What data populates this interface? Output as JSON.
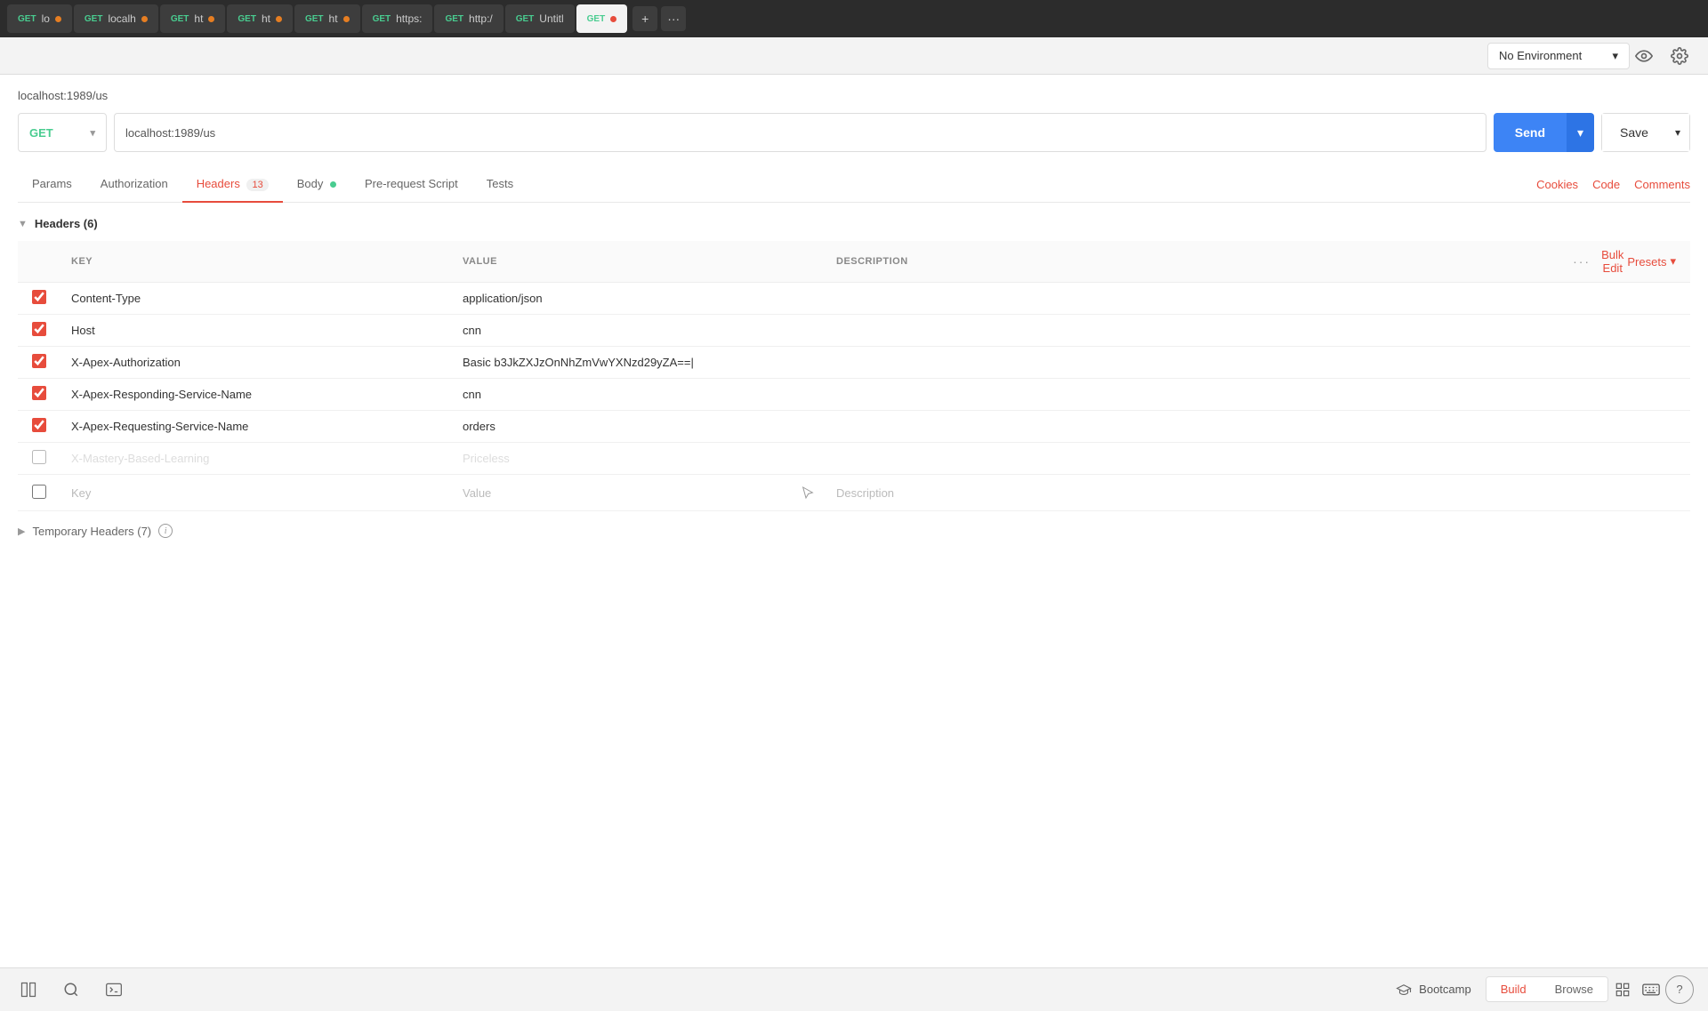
{
  "tabBar": {
    "tabs": [
      {
        "id": "tab1",
        "method": "GET",
        "label": "lo",
        "hasDot": true,
        "dotColor": "orange",
        "active": false
      },
      {
        "id": "tab2",
        "method": "GET",
        "label": "localh",
        "hasDot": true,
        "dotColor": "orange",
        "active": false
      },
      {
        "id": "tab3",
        "method": "GET",
        "label": "ht",
        "hasDot": true,
        "dotColor": "orange",
        "active": false
      },
      {
        "id": "tab4",
        "method": "GET",
        "label": "ht",
        "hasDot": true,
        "dotColor": "orange",
        "active": false
      },
      {
        "id": "tab5",
        "method": "GET",
        "label": "ht",
        "hasDot": true,
        "dotColor": "orange",
        "active": false
      },
      {
        "id": "tab6",
        "method": "GET",
        "label": "https:",
        "hasDot": false,
        "active": false
      },
      {
        "id": "tab7",
        "method": "GET",
        "label": "http:/",
        "hasDot": false,
        "active": false
      },
      {
        "id": "tab8",
        "method": "GET",
        "label": "Untitl",
        "hasDot": false,
        "active": false
      },
      {
        "id": "tab9",
        "method": "GET",
        "label": "GET",
        "hasDot": true,
        "dotColor": "active",
        "active": true
      }
    ],
    "addTabLabel": "+",
    "moreLabel": "···"
  },
  "envBar": {
    "environmentLabel": "No Environment",
    "chevron": "▾"
  },
  "request": {
    "breadcrumb": "localhost:1989/us",
    "method": "GET",
    "methodChevron": "▾",
    "url": "localhost:1989/us",
    "sendLabel": "Send",
    "sendChevron": "▾",
    "saveLabel": "Save",
    "saveChevron": "▾"
  },
  "requestTabs": {
    "tabs": [
      {
        "id": "params",
        "label": "Params",
        "active": false
      },
      {
        "id": "authorization",
        "label": "Authorization",
        "active": false
      },
      {
        "id": "headers",
        "label": "Headers",
        "badge": "13",
        "active": true
      },
      {
        "id": "body",
        "label": "Body",
        "hasDot": true,
        "active": false
      },
      {
        "id": "pre-request",
        "label": "Pre-request Script",
        "active": false
      },
      {
        "id": "tests",
        "label": "Tests",
        "active": false
      }
    ],
    "rightLinks": [
      {
        "id": "cookies",
        "label": "Cookies"
      },
      {
        "id": "code",
        "label": "Code"
      },
      {
        "id": "comments",
        "label": "Comments"
      }
    ]
  },
  "headersSection": {
    "title": "Headers",
    "count": "(6)",
    "columns": {
      "key": "KEY",
      "value": "VALUE",
      "description": "DESCRIPTION"
    },
    "bulkEdit": "Bulk Edit",
    "presets": "Presets",
    "presetChevron": "▾",
    "rows": [
      {
        "id": "row1",
        "checked": true,
        "key": "Content-Type",
        "value": "application/json",
        "description": "",
        "disabled": false
      },
      {
        "id": "row2",
        "checked": true,
        "key": "Host",
        "value": "cnn",
        "description": "",
        "disabled": false
      },
      {
        "id": "row3",
        "checked": true,
        "key": "X-Apex-Authorization",
        "value": "Basic b3JkZXJzOnNhZmVwYXNzd29yZA==",
        "description": "",
        "disabled": false,
        "cursor": true
      },
      {
        "id": "row4",
        "checked": true,
        "key": "X-Apex-Responding-Service-Name",
        "value": "cnn",
        "description": "",
        "disabled": false
      },
      {
        "id": "row5",
        "checked": true,
        "key": "X-Apex-Requesting-Service-Name",
        "value": "orders",
        "description": "",
        "disabled": false
      },
      {
        "id": "row6",
        "checked": false,
        "key": "X-Mastery-Based-Learning",
        "value": "Priceless",
        "description": "",
        "disabled": true
      },
      {
        "id": "row7",
        "checked": false,
        "key": "",
        "keyPlaceholder": "Key",
        "value": "",
        "valuePlaceholder": "Value",
        "description": "",
        "descPlaceholder": "Description",
        "disabled": true,
        "empty": true
      }
    ],
    "temporaryHeaders": {
      "label": "Temporary Headers",
      "count": "(7)",
      "infoTooltip": "i"
    }
  },
  "bottomBar": {
    "bootcampLabel": "Bootcamp",
    "buildLabel": "Build",
    "browseLabel": "Browse"
  }
}
